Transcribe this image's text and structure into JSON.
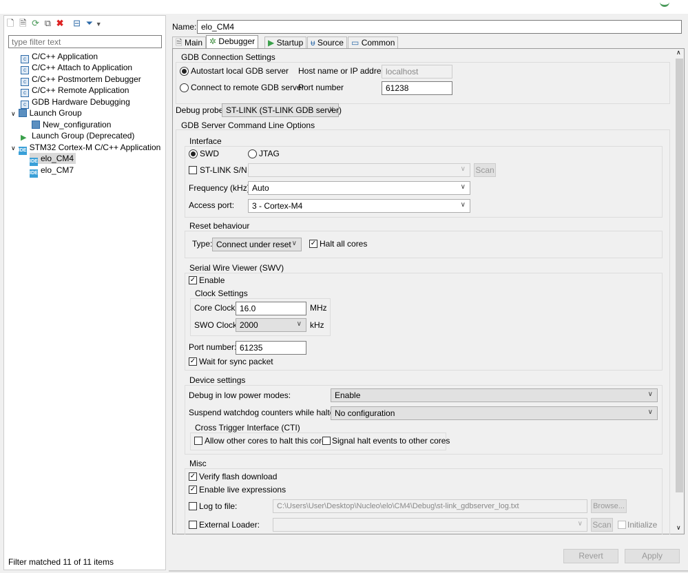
{
  "left": {
    "filter_placeholder": "type filter text",
    "status": "Filter matched 11 of 11 items",
    "tree": [
      "C/C++ Application",
      "C/C++ Attach to Application",
      "C/C++ Postmortem Debugger",
      "C/C++ Remote Application",
      "GDB Hardware Debugging",
      "Launch Group",
      "New_configuration",
      "Launch Group (Deprecated)",
      "STM32 Cortex-M C/C++ Application",
      "elo_CM4",
      "elo_CM7"
    ]
  },
  "name_label": "Name:",
  "name_value": "elo_CM4",
  "tabs": [
    "Main",
    "Debugger",
    "Startup",
    "Source",
    "Common"
  ],
  "gdb": {
    "title": "GDB Connection Settings",
    "autostart": "Autostart local GDB server",
    "remote": "Connect to remote GDB server",
    "host_label": "Host name or IP address",
    "host_value": "localhost",
    "port_label": "Port number",
    "port_value": "61238"
  },
  "probe": {
    "label": "Debug probe",
    "value": "ST-LINK (ST-LINK GDB server)"
  },
  "cmd_title": "GDB Server Command Line Options",
  "iface": {
    "title": "Interface",
    "swd": "SWD",
    "jtag": "JTAG",
    "sn": "ST-LINK S/N",
    "scan": "Scan",
    "freq_label": "Frequency (kHz):",
    "freq_value": "Auto",
    "ap_label": "Access port:",
    "ap_value": "3 - Cortex-M4"
  },
  "reset": {
    "title": "Reset behaviour",
    "type_label": "Type:",
    "type_value": "Connect under reset",
    "halt": "Halt all cores"
  },
  "swv": {
    "title": "Serial Wire Viewer (SWV)",
    "enable": "Enable",
    "clock_title": "Clock Settings",
    "core_label": "Core Clock:",
    "core_value": "16.0",
    "core_unit": "MHz",
    "swo_label": "SWO Clock:",
    "swo_value": "2000",
    "swo_unit": "kHz",
    "port_label": "Port number:",
    "port_value": "61235",
    "wait": "Wait for sync packet"
  },
  "device": {
    "title": "Device settings",
    "lp_label": "Debug in low power modes:",
    "lp_value": "Enable",
    "wd_label": "Suspend watchdog counters while halted:",
    "wd_value": "No configuration",
    "cti_title": "Cross Trigger Interface (CTI)",
    "cti_allow": "Allow other cores to halt this core",
    "cti_signal": "Signal halt events to other cores"
  },
  "misc": {
    "title": "Misc",
    "verify": "Verify flash download",
    "live": "Enable live expressions",
    "log_label": "Log to file:",
    "log_value": "C:\\Users\\User\\Desktop\\Nucleo\\elo\\CM4\\Debug\\st-link_gdbserver_log.txt",
    "browse": "Browse...",
    "ext_label": "External Loader:",
    "scan": "Scan",
    "initialize": "Initialize"
  },
  "buttons": {
    "revert": "Revert",
    "apply": "Apply"
  }
}
